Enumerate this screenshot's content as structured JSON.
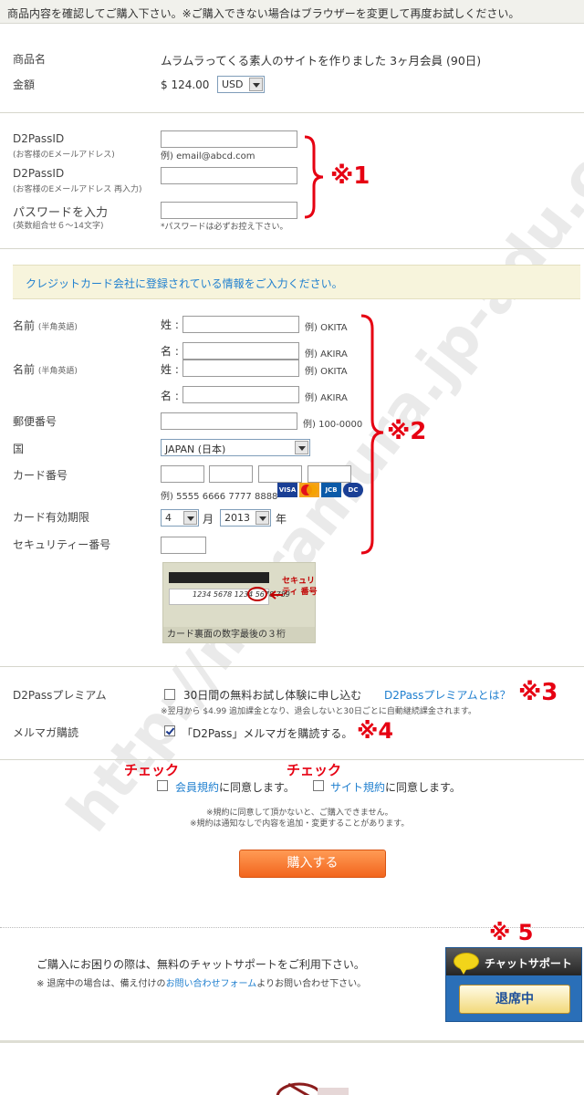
{
  "notice": "商品内容を確認してご購入下さい。※ご購入できない場合はブラウザーを変更して再度お試しください。",
  "product": {
    "name_label": "商品名",
    "name_value": "ムラムラってくる素人のサイトを作りました 3ヶ月会員 (90日)",
    "price_label": "金額",
    "price_value": "$ 124.00",
    "currency": "USD"
  },
  "account": {
    "id_label": "D2PassID",
    "id_sub": "(お客様のEメールアドレス)",
    "id_hint": "例) email@abcd.com",
    "id2_label": "D2PassID",
    "id2_sub": "(お客様のEメールアドレス 再入力)",
    "pw_label": "パスワードを入力",
    "pw_sub": "(英数組合せ６～14文字)",
    "pw_hint": "*パスワードは必ずお控え下さい。"
  },
  "annotations": {
    "n1": "※1",
    "n2": "※2",
    "n3": "※3",
    "n4": "※4",
    "n5": "※ 5",
    "check1": "チェック",
    "check2": "チェック"
  },
  "card_section": {
    "banner": "クレジットカード会社に登録されている情報をご入力ください。",
    "name_label": "名前",
    "name_sub": "(半角英語)",
    "last_label": "姓 :",
    "first_label": "名 :",
    "last_example": "例) OKITA",
    "first_example": "例) AKIRA",
    "zip_label": "郵便番号",
    "zip_example": "例) 100-0000",
    "country_label": "国",
    "country_value": "JAPAN (日本)",
    "cardno_label": "カード番号",
    "cardno_example": "例) 5555 6666 7777 8888",
    "expiry_label": "カード有効期限",
    "expiry_month": "4",
    "expiry_month_unit": "月",
    "expiry_year": "2013",
    "expiry_year_unit": "年",
    "cvv_label": "セキュリティー番号",
    "card_image_numbers": "1234 5678 1234 5678",
    "card_image_cvv": "789",
    "card_image_security": "セキュリティ 番号",
    "card_image_caption": "カード裏面の数字最後の３桁",
    "logos": [
      "VISA",
      "MC",
      "JCB",
      "DC"
    ]
  },
  "options": {
    "premium_label": "D2Passプレミアム",
    "premium_text": "30日間の無料お試し体験に申し込む",
    "premium_link": "D2Passプレミアムとは？",
    "premium_note": "※翌月から $4.99 追加課金となり、退会しないと30日ごとに自動継続課金されます。",
    "mailmag_label": "メルマガ購読",
    "mailmag_text": "「D2Pass」メルマガを購読する。"
  },
  "agree": {
    "terms_link": "会員規約",
    "terms_text": "に同意します。",
    "site_link": "サイト規約",
    "site_text": "に同意します。",
    "note1": "※規約に同意して頂かないと、ご購入できません。",
    "note2": "※規約は通知なしで内容を追加・変更することがあります。"
  },
  "buy_button": "購入する",
  "support": {
    "line1": "ご購入にお困りの際は、無料のチャットサポートをご利用下さい。",
    "line2_prefix": "※ 退席中の場合は、備え付けの",
    "line2_link": "お問い合わせフォーム",
    "line2_suffix": "よりお問い合わせ下さい。",
    "chat_title": "チャットサポート",
    "chat_status": "退席中"
  },
  "watermark": "http://muramura.jp-adu.com",
  "colors": {
    "annotation_red": "#e60012",
    "link_blue": "#1f7fcf",
    "buy_orange": "#f2651d",
    "banner_bg": "#f7f4dc"
  }
}
